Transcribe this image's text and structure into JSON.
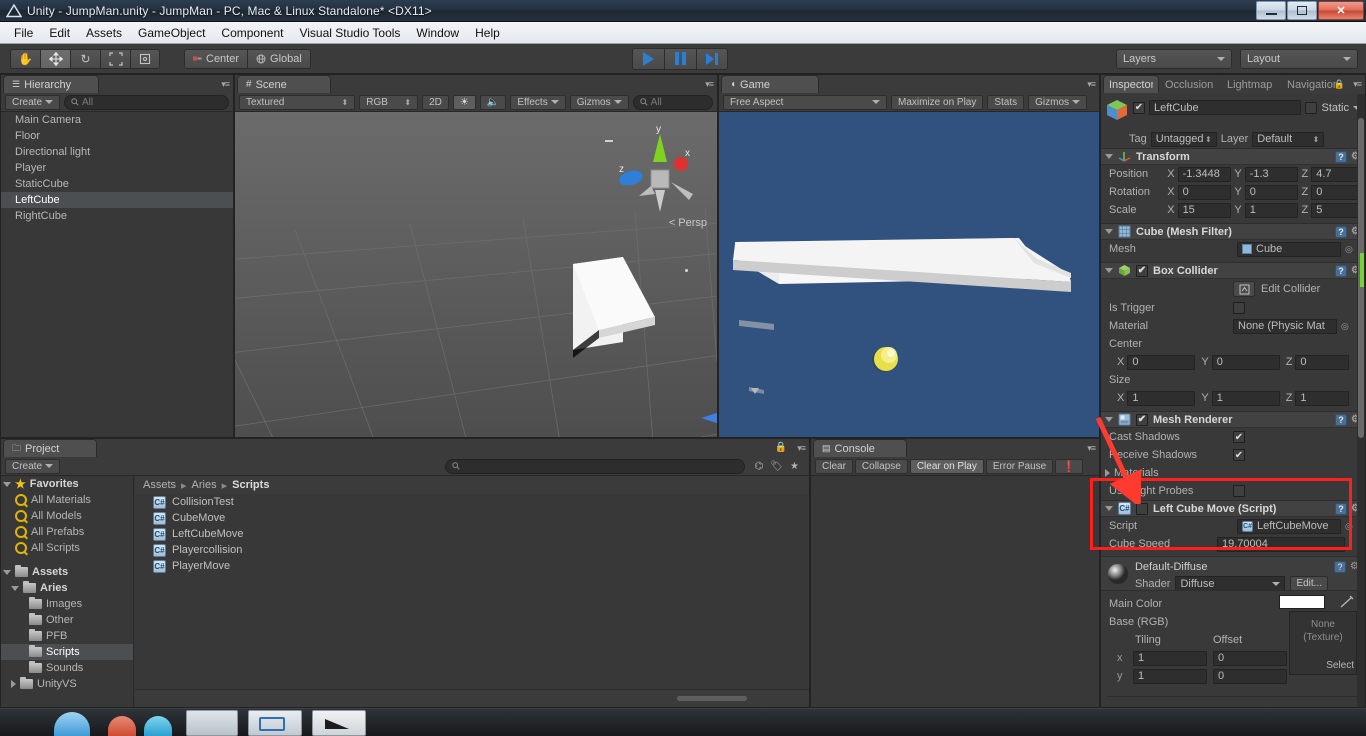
{
  "window": {
    "title": "Unity - JumpMan.unity - JumpMan - PC, Mac & Linux Standalone* <DX11>",
    "minimize": "—",
    "maximize": "□",
    "close": "✕"
  },
  "menu": [
    "File",
    "Edit",
    "Assets",
    "GameObject",
    "Component",
    "Visual Studio Tools",
    "Window",
    "Help"
  ],
  "toolbar": {
    "tools": [
      "hand-tool",
      "move-tool",
      "rotate-tool",
      "scale-tool",
      "rect-tool"
    ],
    "pivot": "Center",
    "space": "Global",
    "play": "play-button",
    "pause": "pause-button",
    "step": "step-button",
    "layers": "Layers",
    "layout": "Layout"
  },
  "hierarchy": {
    "tab": "Hierarchy",
    "create": "Create",
    "search_placeholder": "All",
    "items": [
      {
        "label": "Main Camera",
        "selected": false
      },
      {
        "label": "Floor",
        "selected": false
      },
      {
        "label": "Directional light",
        "selected": false
      },
      {
        "label": "Player",
        "selected": false
      },
      {
        "label": "StaticCube",
        "selected": false
      },
      {
        "label": "LeftCube",
        "selected": true
      },
      {
        "label": "RightCube",
        "selected": false
      }
    ]
  },
  "scene": {
    "tab": "Scene",
    "draw_mode": "Textured",
    "color_mode": "RGB",
    "twod": "2D",
    "light": "lighting-toggle",
    "audio": "audio-toggle",
    "effects": "Effects",
    "gizmos": "Gizmos",
    "search_placeholder": "All",
    "gizmo_axes": {
      "x": "x",
      "y": "y",
      "z": "z"
    },
    "projection": "Persp"
  },
  "game": {
    "tab": "Game",
    "aspect": "Free Aspect",
    "maximize": "Maximize on Play",
    "stats": "Stats",
    "gizmos": "Gizmos"
  },
  "console": {
    "tab": "Console",
    "clear": "Clear",
    "collapse": "Collapse",
    "clear_on_play": "Clear on Play",
    "error_pause": "Error Pause",
    "messages": []
  },
  "project": {
    "tab": "Project",
    "create": "Create",
    "search_placeholder": "",
    "breadcrumb": [
      "Assets",
      "Aries",
      "Scripts"
    ],
    "tree": [
      {
        "label": "Favorites",
        "depth": 0,
        "icon": "star-icon",
        "expanded": true,
        "bold": true
      },
      {
        "label": "All Materials",
        "depth": 1,
        "icon": "search-icon"
      },
      {
        "label": "All Models",
        "depth": 1,
        "icon": "search-icon"
      },
      {
        "label": "All Prefabs",
        "depth": 1,
        "icon": "search-icon"
      },
      {
        "label": "All Scripts",
        "depth": 1,
        "icon": "search-icon"
      },
      {
        "label": "Assets",
        "depth": 0,
        "icon": "folder-icon",
        "expanded": true,
        "bold": true
      },
      {
        "label": "Aries",
        "depth": 1,
        "icon": "folder-icon",
        "expanded": true
      },
      {
        "label": "Images",
        "depth": 2,
        "icon": "folder-icon"
      },
      {
        "label": "Other",
        "depth": 2,
        "icon": "folder-icon"
      },
      {
        "label": "PFB",
        "depth": 2,
        "icon": "folder-icon"
      },
      {
        "label": "Scripts",
        "depth": 2,
        "icon": "folder-icon",
        "selected": true
      },
      {
        "label": "Sounds",
        "depth": 2,
        "icon": "folder-icon"
      },
      {
        "label": "UnityVS",
        "depth": 1,
        "icon": "folder-icon",
        "collapsed": true
      }
    ],
    "files": [
      {
        "label": "CollisionTest",
        "icon": "csharp-script-icon"
      },
      {
        "label": "CubeMove",
        "icon": "csharp-script-icon"
      },
      {
        "label": "LeftCubeMove",
        "icon": "csharp-script-icon"
      },
      {
        "label": "Playercollision",
        "icon": "csharp-script-icon"
      },
      {
        "label": "PlayerMove",
        "icon": "csharp-script-icon"
      }
    ]
  },
  "inspector": {
    "tabs": [
      "Inspector",
      "Occlusion",
      "Lightmap",
      "Navigation"
    ],
    "object_name": "LeftCube",
    "object_enabled": true,
    "static_label": "Static",
    "tag_label": "Tag",
    "tag_value": "Untagged",
    "layer_label": "Layer",
    "layer_value": "Default",
    "transform": {
      "title": "Transform",
      "rows": [
        {
          "label": "Position",
          "x": "-1.3448",
          "y": "-1.3",
          "z": "4.7"
        },
        {
          "label": "Rotation",
          "x": "0",
          "y": "0",
          "z": "0"
        },
        {
          "label": "Scale",
          "x": "15",
          "y": "1",
          "z": "5"
        }
      ]
    },
    "mesh_filter": {
      "title": "Cube (Mesh Filter)",
      "mesh_label": "Mesh",
      "mesh_value": "Cube"
    },
    "box_collider": {
      "title": "Box Collider",
      "enabled": true,
      "edit_collider": "Edit Collider",
      "is_trigger_label": "Is Trigger",
      "is_trigger": false,
      "material_label": "Material",
      "material_value": "None (Physic Mat",
      "center_label": "Center",
      "center": {
        "x": "0",
        "y": "0",
        "z": "0"
      },
      "size_label": "Size",
      "size": {
        "x": "1",
        "y": "1",
        "z": "1"
      }
    },
    "mesh_renderer": {
      "title": "Mesh Renderer",
      "enabled": true,
      "cast_shadows_label": "Cast Shadows",
      "cast_shadows": true,
      "receive_shadows_label": "Receive Shadows",
      "receive_shadows": true,
      "materials_label": "Materials",
      "use_light_probes_label": "Use Light Probes",
      "use_light_probes": false
    },
    "script_component": {
      "title": "Left Cube Move (Script)",
      "enabled": false,
      "script_label": "Script",
      "script_value": "LeftCubeMove",
      "speed_label": "Cube Speed",
      "speed_value": "19.70004"
    },
    "material": {
      "title": "Default-Diffuse",
      "shader_label": "Shader",
      "shader_value": "Diffuse",
      "edit_label": "Edit...",
      "main_color_label": "Main Color",
      "main_color": "#ffffff",
      "base_rgb_label": "Base (RGB)",
      "texture_none": "None\n(Texture)",
      "select_label": "Select",
      "tiling_label": "Tiling",
      "offset_label": "Offset",
      "rows": [
        {
          "axis": "x",
          "tiling": "1",
          "offset": "0"
        },
        {
          "axis": "y",
          "tiling": "1",
          "offset": "0"
        }
      ]
    }
  },
  "annotation": {
    "highlight_color": "#ff1f1f",
    "arrow_color": "#ff3b30"
  }
}
